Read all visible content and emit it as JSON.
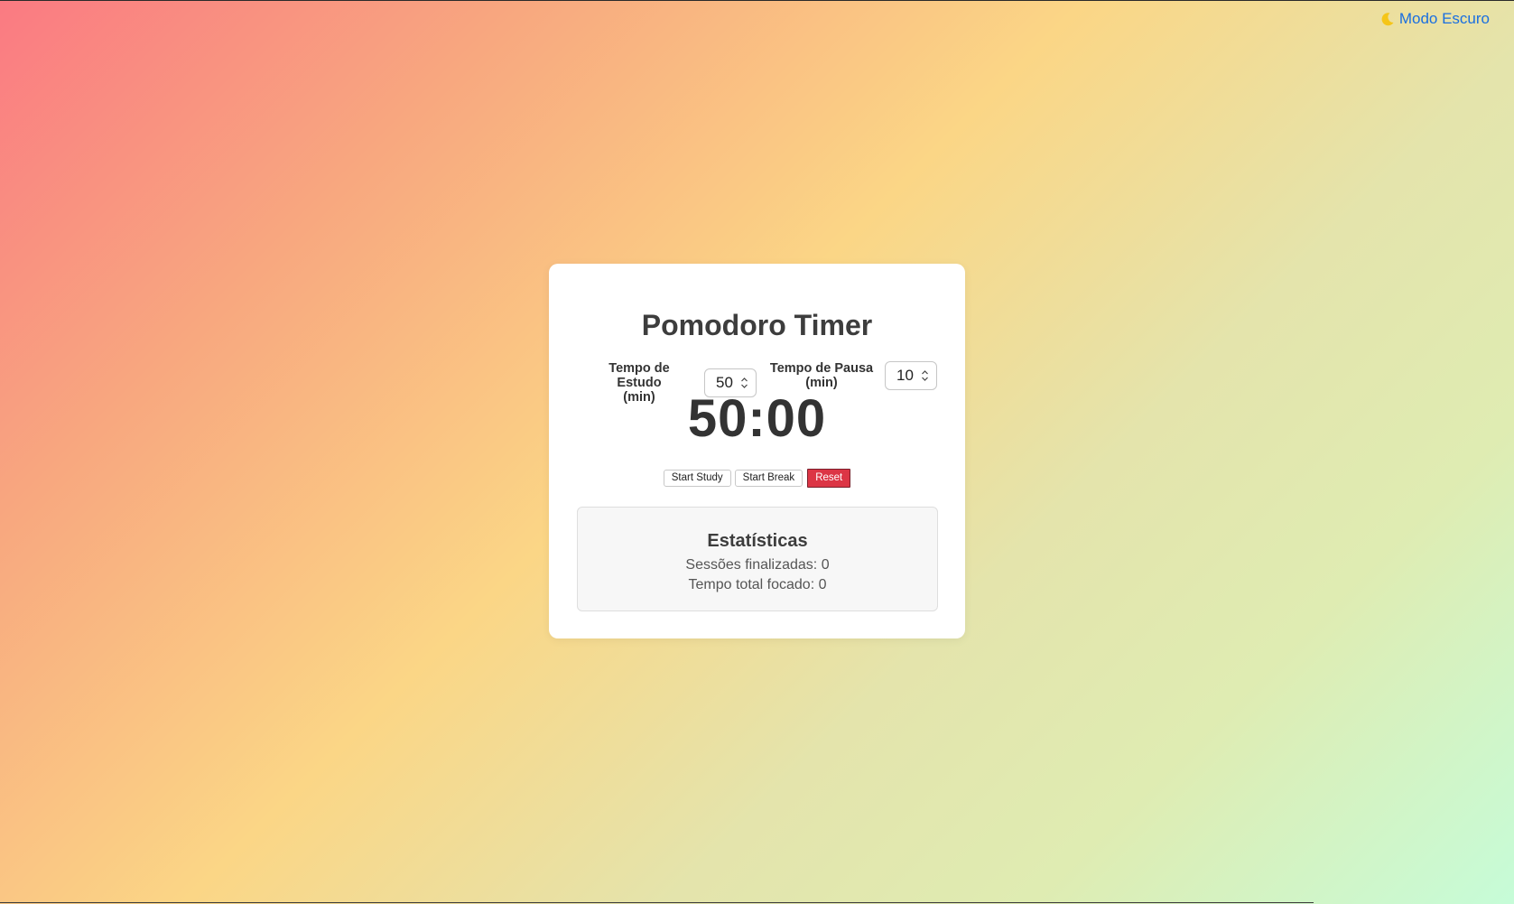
{
  "dark_mode_toggle": {
    "icon": "moon-icon",
    "label": "Modo Escuro"
  },
  "app": {
    "title": "Pomodoro Timer"
  },
  "settings": {
    "study_label_line1": "Tempo de Estudo",
    "study_label_line2": "(min)",
    "study_value": "50",
    "break_label_line1": "Tempo de Pausa",
    "break_label_line2": "(min)",
    "break_value": "10"
  },
  "timer": {
    "display": "50:00"
  },
  "buttons": {
    "start_study": "Start Study",
    "start_break": "Start Break",
    "reset": "Reset"
  },
  "stats": {
    "title": "Estatísticas",
    "sessions_text": "Sessões finalizadas: 0",
    "total_focus_text": "Tempo total focado: 0"
  },
  "colors": {
    "accent_link": "#1a6fe0",
    "reset_button": "#dc3545",
    "moon": "#f5c518"
  }
}
